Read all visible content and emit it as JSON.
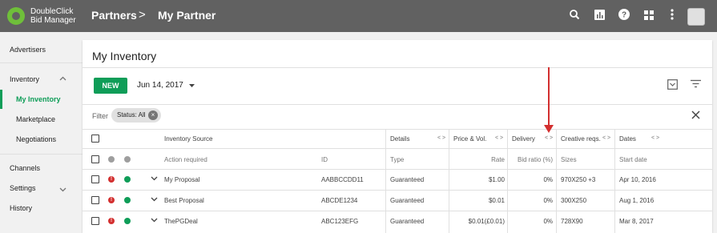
{
  "app": {
    "brand_line1": "DoubleClick",
    "brand_line2": "Bid Manager"
  },
  "breadcrumb": {
    "root": "Partners",
    "separator": ">",
    "current": "My Partner"
  },
  "topbar_icons": [
    "search-icon",
    "reports-icon",
    "help-icon",
    "apps-icon",
    "more-vert-icon"
  ],
  "sidebar": {
    "advertisers": "Advertisers",
    "inventory": "Inventory",
    "my_inventory": "My Inventory",
    "marketplace": "Marketplace",
    "negotiations": "Negotiations",
    "channels": "Channels",
    "settings": "Settings",
    "history": "History"
  },
  "page": {
    "title": "My Inventory",
    "new_button": "NEW",
    "date": "Jun 14, 2017",
    "filter_label": "Filter",
    "chip": "Status: All"
  },
  "table": {
    "headers": {
      "source": "Inventory Source",
      "details": "Details",
      "price": "Price & Vol.",
      "delivery": "Delivery",
      "creative": "Creative reqs.",
      "dates": "Dates"
    },
    "subheaders": {
      "action": "Action required",
      "id": "ID",
      "type": "Type",
      "rate": "Rate",
      "bid_ratio": "Bid ratio (%)",
      "sizes": "Sizes",
      "start": "Start date"
    },
    "rows": [
      {
        "name": "My Proposal",
        "id": "AABBCCDD11",
        "type": "Guaranteed",
        "rate": "$1.00",
        "bid_ratio": "0%",
        "sizes": "970X250 +3",
        "start": "Apr 10, 2016"
      },
      {
        "name": "Best Proposal",
        "id": "ABCDE1234",
        "type": "Guaranteed",
        "rate": "$0.01",
        "bid_ratio": "0%",
        "sizes": "300X250",
        "start": "Aug 1, 2016"
      },
      {
        "name": "ThePGDeal",
        "id": "ABC123EFG",
        "type": "Guaranteed",
        "rate": "$0.01(£0.01)",
        "bid_ratio": "0%",
        "sizes": "728X90",
        "start": "Mar 8, 2017"
      }
    ]
  },
  "colors": {
    "topbar": "#616161",
    "accent_green": "#0f9d58",
    "error_red": "#d32f2f",
    "annotation_red": "#d32f2f"
  }
}
